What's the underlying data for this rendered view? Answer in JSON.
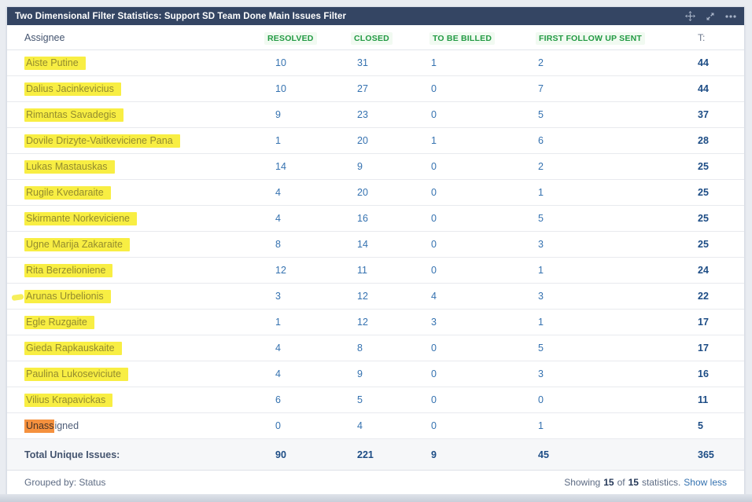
{
  "colors": {
    "gadget_header_bg": "#344563",
    "column_header_green": "#229a43",
    "link_blue": "#3572b0",
    "total_blue": "#1c4c85",
    "highlight_yellow": "#f8ee43",
    "highlight_orange": "#f5913e"
  },
  "icons": [
    "move-icon",
    "expand-icon",
    "more-options-icon"
  ],
  "header": {
    "title": "Two Dimensional Filter Statistics: Support SD Team Done Main Issues Filter"
  },
  "table": {
    "columns": [
      "Assignee",
      "RESOLVED",
      "CLOSED",
      "TO BE BILLED",
      "FIRST FOLLOW UP SENT",
      "T:"
    ],
    "rows": [
      {
        "name": "Aiste Putine",
        "resolved": "10",
        "closed": "31",
        "to_be_billed": "1",
        "first_follow_up_sent": "2",
        "total": "44"
      },
      {
        "name": "Dalius Jacinkevicius",
        "resolved": "10",
        "closed": "27",
        "to_be_billed": "0",
        "first_follow_up_sent": "7",
        "total": "44"
      },
      {
        "name": "Rimantas Savadegis",
        "resolved": "9",
        "closed": "23",
        "to_be_billed": "0",
        "first_follow_up_sent": "5",
        "total": "37"
      },
      {
        "name": "Dovile Drizyte-Vaitkeviciene Pana",
        "resolved": "1",
        "closed": "20",
        "to_be_billed": "1",
        "first_follow_up_sent": "6",
        "total": "28"
      },
      {
        "name": "Lukas Mastauskas",
        "resolved": "14",
        "closed": "9",
        "to_be_billed": "0",
        "first_follow_up_sent": "2",
        "total": "25"
      },
      {
        "name": "Rugile Kvedaraite",
        "resolved": "4",
        "closed": "20",
        "to_be_billed": "0",
        "first_follow_up_sent": "1",
        "total": "25"
      },
      {
        "name": "Skirmante Norkeviciene",
        "resolved": "4",
        "closed": "16",
        "to_be_billed": "0",
        "first_follow_up_sent": "5",
        "total": "25"
      },
      {
        "name": "Ugne Marija Zakaraite",
        "resolved": "8",
        "closed": "14",
        "to_be_billed": "0",
        "first_follow_up_sent": "3",
        "total": "25"
      },
      {
        "name": "Rita Berzelioniene",
        "resolved": "12",
        "closed": "11",
        "to_be_billed": "0",
        "first_follow_up_sent": "1",
        "total": "24"
      },
      {
        "name": "Arunas Urbelionis",
        "resolved": "3",
        "closed": "12",
        "to_be_billed": "4",
        "first_follow_up_sent": "3",
        "total": "22"
      },
      {
        "name": "Egle Ruzgaite",
        "resolved": "1",
        "closed": "12",
        "to_be_billed": "3",
        "first_follow_up_sent": "1",
        "total": "17"
      },
      {
        "name": "Gieda Rapkauskaite",
        "resolved": "4",
        "closed": "8",
        "to_be_billed": "0",
        "first_follow_up_sent": "5",
        "total": "17"
      },
      {
        "name": "Paulina Lukoseviciute",
        "resolved": "4",
        "closed": "9",
        "to_be_billed": "0",
        "first_follow_up_sent": "3",
        "total": "16"
      },
      {
        "name": "Vilius Krapavickas",
        "resolved": "6",
        "closed": "5",
        "to_be_billed": "0",
        "first_follow_up_sent": "0",
        "total": "11"
      },
      {
        "name_hl": "Unass",
        "name_rest": "igned",
        "resolved": "0",
        "closed": "4",
        "to_be_billed": "0",
        "first_follow_up_sent": "1",
        "total": "5"
      }
    ],
    "total_row": {
      "label": "Total Unique Issues:",
      "resolved": "90",
      "closed": "221",
      "to_be_billed": "9",
      "first_follow_up_sent": "45",
      "total": "365"
    }
  },
  "footer": {
    "grouped_by": "Grouped by: Status",
    "showing_text": "Showing",
    "shown_count": "15",
    "of_text": "of",
    "total_count": "15",
    "statistics_text": "statistics.",
    "show_less": "Show less"
  }
}
